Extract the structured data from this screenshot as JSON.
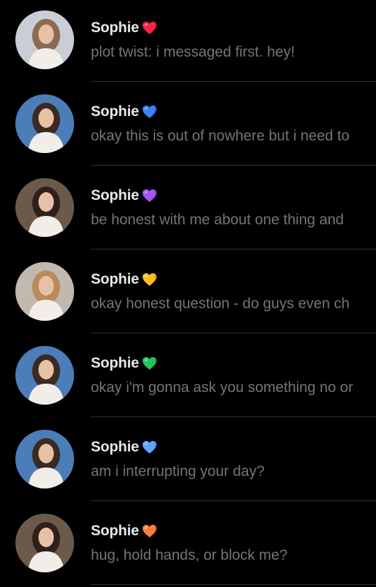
{
  "conversations": [
    {
      "name": "Sophie",
      "preview": "plot twist: i messaged first. hey!",
      "heart_icon": "red-heart-icon",
      "heart_color": "#f4244a",
      "heart_shade": "#c4102f",
      "avatar_icon": "avatar-photo-icon",
      "avatar_bg": "#c9ced6",
      "avatar_fg": "#8a6a52"
    },
    {
      "name": "Sophie",
      "preview": "okay this is out of nowhere but i need to",
      "heart_icon": "blue-heart-icon",
      "heart_color": "#3b82f6",
      "heart_shade": "#1d4fd8",
      "avatar_icon": "avatar-photo-icon",
      "avatar_bg": "#4b7db8",
      "avatar_fg": "#3a2a24"
    },
    {
      "name": "Sophie",
      "preview": "be honest with me about one thing and",
      "heart_icon": "purple-heart-icon",
      "heart_color": "#a855f7",
      "heart_shade": "#7c2fd8",
      "avatar_icon": "avatar-photo-icon",
      "avatar_bg": "#6b5a4c",
      "avatar_fg": "#2e211c"
    },
    {
      "name": "Sophie",
      "preview": "okay honest question - do guys even ch",
      "heart_icon": "yellow-heart-icon",
      "heart_color": "#fbbf24",
      "heart_shade": "#e08a0a",
      "avatar_icon": "avatar-photo-icon",
      "avatar_bg": "#c2b8ad",
      "avatar_fg": "#b98a5c"
    },
    {
      "name": "Sophie",
      "preview": "okay i'm gonna ask you something no or",
      "heart_icon": "green-heart-icon",
      "heart_color": "#22c55e",
      "heart_shade": "#13943f",
      "avatar_icon": "avatar-photo-icon",
      "avatar_bg": "#4b7db8",
      "avatar_fg": "#3a2a24"
    },
    {
      "name": "Sophie",
      "preview": "am i interrupting your day?",
      "heart_icon": "light-blue-heart-icon",
      "heart_color": "#60a5fa",
      "heart_shade": "#2f7ee0",
      "avatar_icon": "avatar-photo-icon",
      "avatar_bg": "#4b7db8",
      "avatar_fg": "#3a2a24"
    },
    {
      "name": "Sophie",
      "preview": "hug, hold hands, or block me?",
      "heart_icon": "orange-heart-icon",
      "heart_color": "#fb7c3c",
      "heart_shade": "#e0531a",
      "avatar_icon": "avatar-photo-icon",
      "avatar_bg": "#6b5a4c",
      "avatar_fg": "#2e211c"
    }
  ]
}
